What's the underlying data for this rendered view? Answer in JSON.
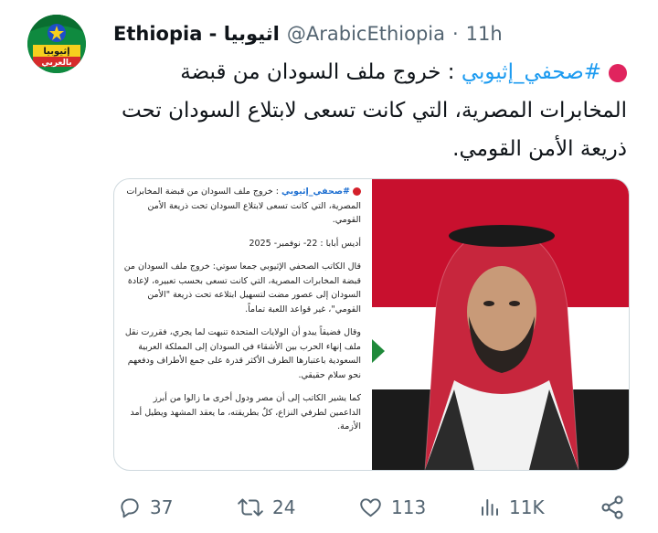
{
  "tweet": {
    "author_name": "Ethiopia - اثيوبيا",
    "handle": "@ArabicEthiopia",
    "separator": "·",
    "time": "11h",
    "avatar_text_top": "إثيوبيا",
    "avatar_text_bottom": "بالعربي",
    "hashtag": "#صحفي_إثيوبي",
    "text": " : خروج ملف السودان من قبضة المخابرات المصرية، التي كانت تسعى لابتلاع السودان تحت ذريعة الأمن القومي."
  },
  "card": {
    "hashtag": "#صحفي_إثيوبي",
    "headline": " : خروج ملف السودان من قبضة المخابرات المصرية، التي كانت تسعى لابتلاع السودان تحت ذريعة الأمن القومي.",
    "dateline": "أديس أبابا : 22- نوفمبر- 2025",
    "para1": "قال الكاتب الصحفي الإثيوبي جمعا سوتي: خروج ملف السودان من قبضة المخابرات المصرية، التي كانت تسعى بحسب تعبيره، لإعادة السودان إلى عصور مضت لتسهيل ابتلاعه تحت ذريعة \"الأمن القومي\"، غير قواعد اللعبة تماماً.",
    "para2": "وقال فضيقاً يبدو أن الولايات المتحدة تنبهت لما يجري، فقررت نقل ملف إنهاء الحرب بين الأشقاء في السودان إلى المملكة العربية السعودية باعتبارها الطرف الأكثر قدرة على جمع الأطراف ودفعهم نحو سلام حقيقي.",
    "para3": "كما يشير الكاتب إلى أن مصر ودول أخرى ما زالوا من أبرز الداعمين لطرفي النزاع، كلٌ بطريقته، ما يعقد المشهد ويطيل أمد الأزمة."
  },
  "actions": {
    "replies": "37",
    "retweets": "24",
    "likes": "113",
    "views": "11K"
  },
  "icons": [
    "reply-icon",
    "retweet-icon",
    "like-icon",
    "views-icon",
    "share-icon"
  ],
  "colors": {
    "link": "#1d9bf0",
    "muted": "#536471",
    "red_dot": "#e0245e"
  }
}
